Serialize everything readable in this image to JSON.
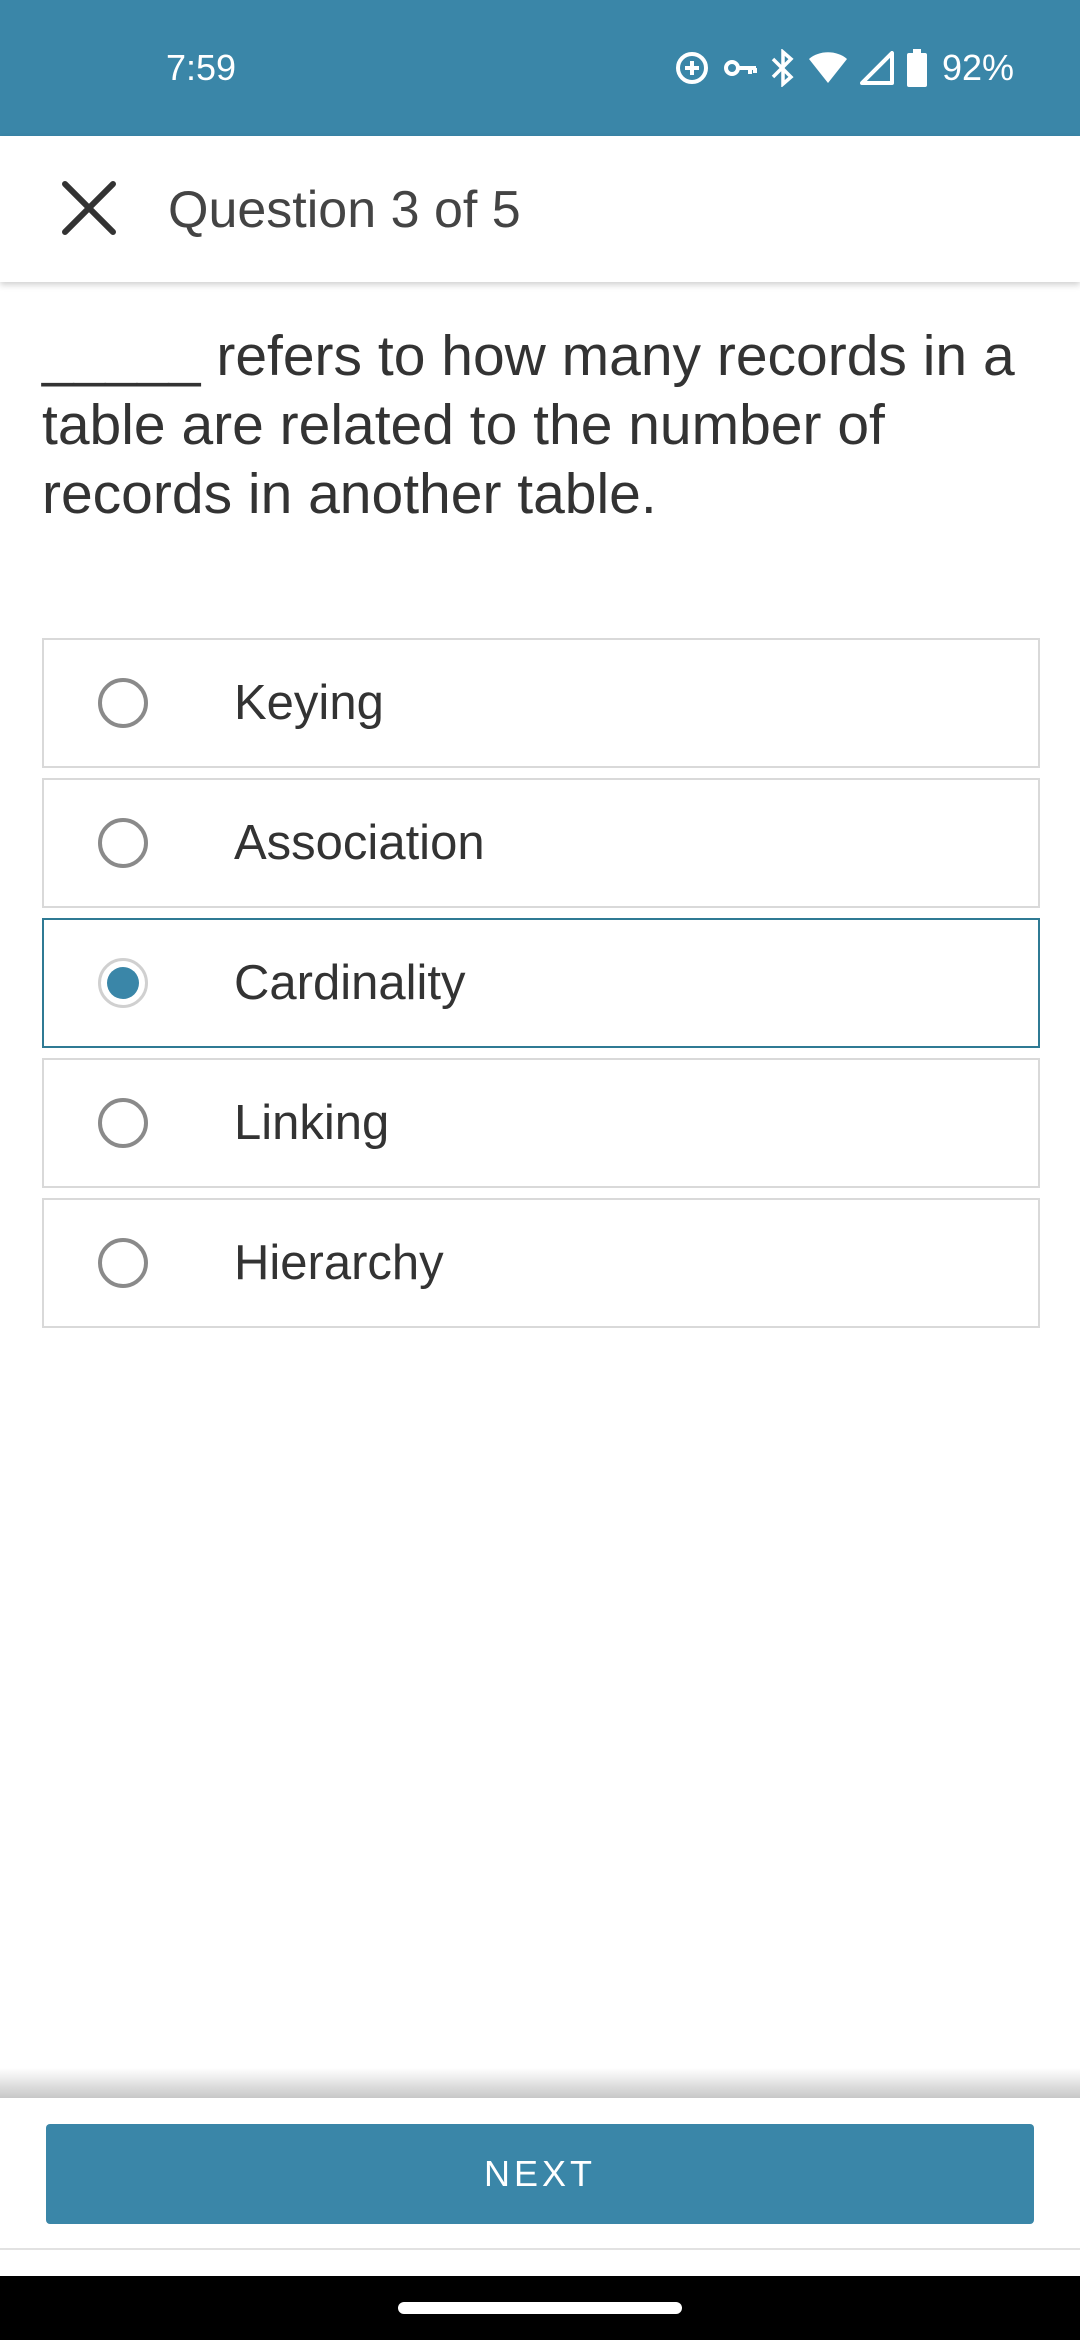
{
  "status_bar": {
    "time": "7:59",
    "battery_percent": "92%",
    "icons": [
      "data-saver-icon",
      "vpn-key-icon",
      "bluetooth-icon",
      "wifi-icon",
      "signal-icon",
      "battery-icon"
    ]
  },
  "header": {
    "title": "Question 3 of 5",
    "close_icon": "close-icon"
  },
  "question": {
    "text": "_____ refers to how many records in a table are related to the number of records in another table."
  },
  "options": [
    {
      "label": "Keying",
      "selected": false
    },
    {
      "label": "Association",
      "selected": false
    },
    {
      "label": "Cardinality",
      "selected": true
    },
    {
      "label": "Linking",
      "selected": false
    },
    {
      "label": "Hierarchy",
      "selected": false
    }
  ],
  "footer": {
    "next_label": "NEXT"
  },
  "colors": {
    "accent": "#3a86a8",
    "selected_border": "#2f7a94"
  }
}
